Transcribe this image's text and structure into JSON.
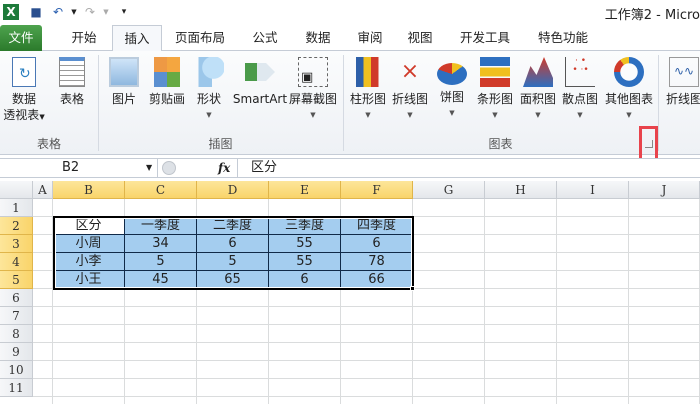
{
  "window": {
    "title": "工作簿2 - Micro"
  },
  "quick_access": [
    "excel-logo",
    "save",
    "undo",
    "redo",
    "customize"
  ],
  "tabs": [
    "文件",
    "开始",
    "插入",
    "页面布局",
    "公式",
    "数据",
    "审阅",
    "视图",
    "开发工具",
    "特色功能"
  ],
  "ribbon": {
    "groups": [
      "表格",
      "插图",
      "图表"
    ],
    "table_buttons": [
      "数据",
      "透视表",
      "表格"
    ],
    "illustration_buttons": [
      "图片",
      "剪贴画",
      "形状",
      "SmartArt",
      "屏幕截图"
    ],
    "chart_buttons": [
      "柱形图",
      "折线图",
      "饼图",
      "条形图",
      "面积图",
      "散点图",
      "其他图表"
    ],
    "sparkline_button": "折线图"
  },
  "formula_bar": {
    "name_box": "B2",
    "fx": "fx",
    "value": "区分"
  },
  "columns": [
    "A",
    "B",
    "C",
    "D",
    "E",
    "F",
    "G",
    "H",
    "I",
    "J"
  ],
  "rows": [
    "1",
    "2",
    "3",
    "4",
    "5",
    "6",
    "7",
    "8",
    "9",
    "10",
    "11"
  ],
  "table": {
    "header": [
      "区分",
      "一季度",
      "二季度",
      "三季度",
      "四季度"
    ],
    "rows": [
      [
        "小周",
        "34",
        "6",
        "55",
        "6"
      ],
      [
        "小李",
        "5",
        "5",
        "55",
        "78"
      ],
      [
        "小王",
        "45",
        "65",
        "6",
        "66"
      ]
    ]
  }
}
